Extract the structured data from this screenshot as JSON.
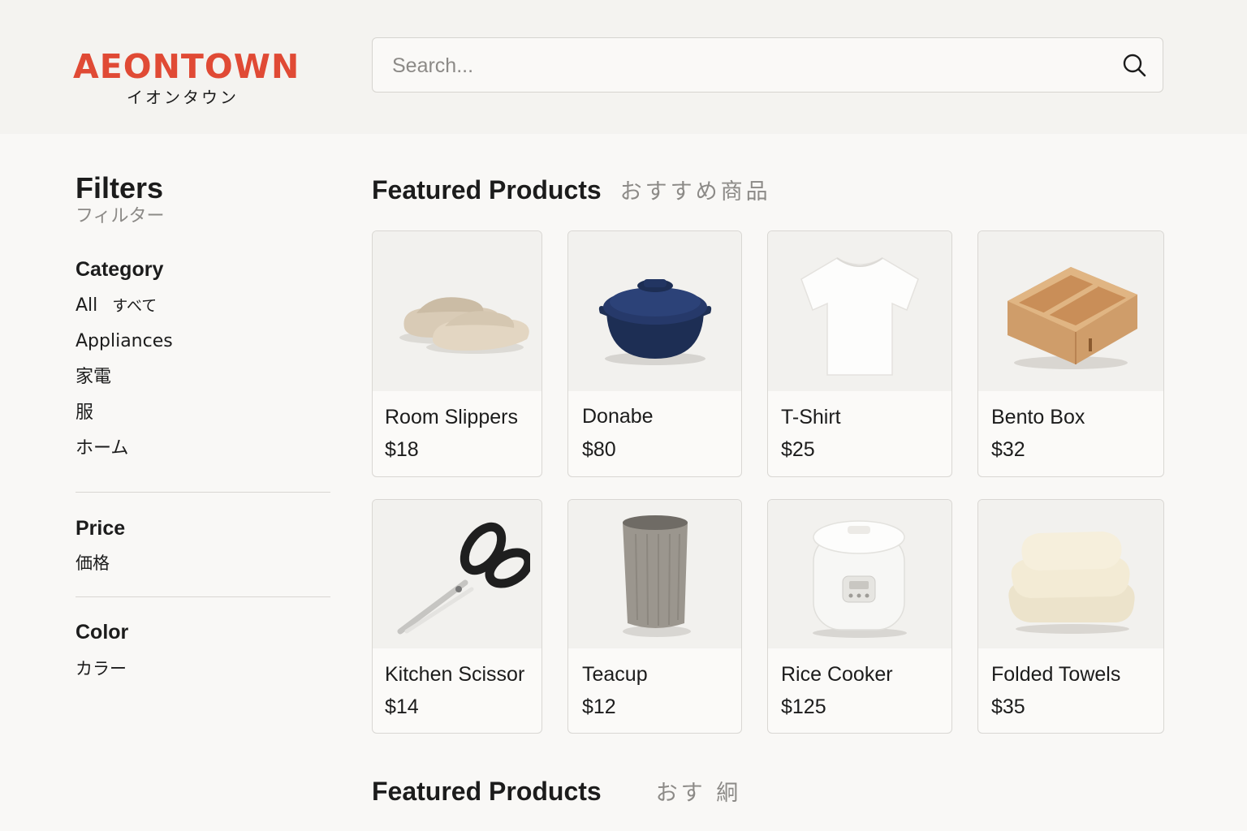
{
  "brand": {
    "name": "AEONTOWN",
    "name_jp": "イオンタウン",
    "color": "#e04a35"
  },
  "search": {
    "placeholder": "Search...",
    "icon": "search-icon"
  },
  "sidebar": {
    "title": "Filters",
    "title_jp": "フィルター",
    "category": {
      "title": "Category",
      "items": [
        {
          "label": "All",
          "label_jp": "すべて"
        },
        {
          "label": "Appliances"
        },
        {
          "label": "家電"
        },
        {
          "label": "服"
        },
        {
          "label": "ホーム"
        }
      ]
    },
    "price": {
      "title": "Price",
      "title_jp": "価格"
    },
    "color": {
      "title": "Color",
      "title_jp": "カラー"
    }
  },
  "main": {
    "heading": "Featured Products",
    "heading_jp": "おすすめ商品",
    "products": [
      {
        "name": "Room Slippers",
        "price": "$18",
        "icon": "slippers-icon"
      },
      {
        "name": "Donabe",
        "price": "$80",
        "icon": "donabe-pot-icon"
      },
      {
        "name": "T-Shirt",
        "price": "$25",
        "icon": "t-shirt-icon"
      },
      {
        "name": "Bento Box",
        "price": "$32",
        "icon": "bento-box-icon"
      },
      {
        "name": "Kitchen Scissor",
        "price": "$14",
        "icon": "scissors-icon"
      },
      {
        "name": "Teacup",
        "price": "$12",
        "icon": "teacup-icon"
      },
      {
        "name": "Rice Cooker",
        "price": "$125",
        "icon": "rice-cooker-icon"
      },
      {
        "name": "Folded Towels",
        "price": "$35",
        "icon": "towels-icon"
      }
    ],
    "heading2": "Featured Products",
    "heading2_jp": "おす 絅"
  }
}
